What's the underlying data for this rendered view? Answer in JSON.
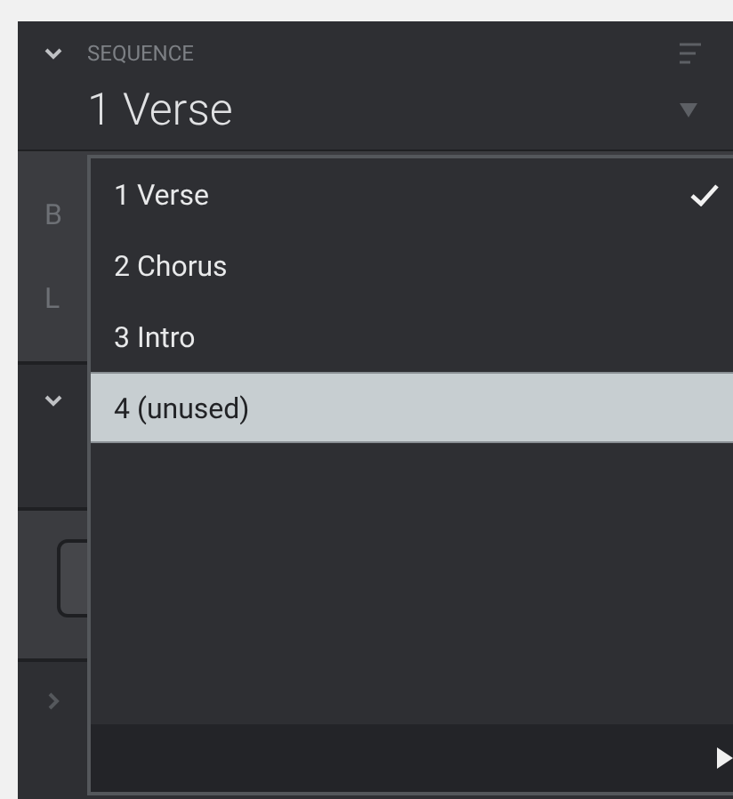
{
  "header": {
    "label": "SEQUENCE",
    "value": "1 Verse",
    "expanded": true
  },
  "panel_sections": [
    {
      "kind": "labels",
      "labels": [
        "B",
        "L"
      ]
    },
    {
      "kind": "collapsible",
      "expanded": true
    },
    {
      "kind": "button"
    },
    {
      "kind": "collapsible",
      "expanded": false
    }
  ],
  "menu": {
    "items": [
      {
        "label": "1 Verse",
        "selected": true,
        "highlighted": false
      },
      {
        "label": "2 Chorus",
        "selected": false,
        "highlighted": false
      },
      {
        "label": "3 Intro",
        "selected": false,
        "highlighted": false
      },
      {
        "label": "4 (unused)",
        "selected": false,
        "highlighted": true
      }
    ]
  }
}
